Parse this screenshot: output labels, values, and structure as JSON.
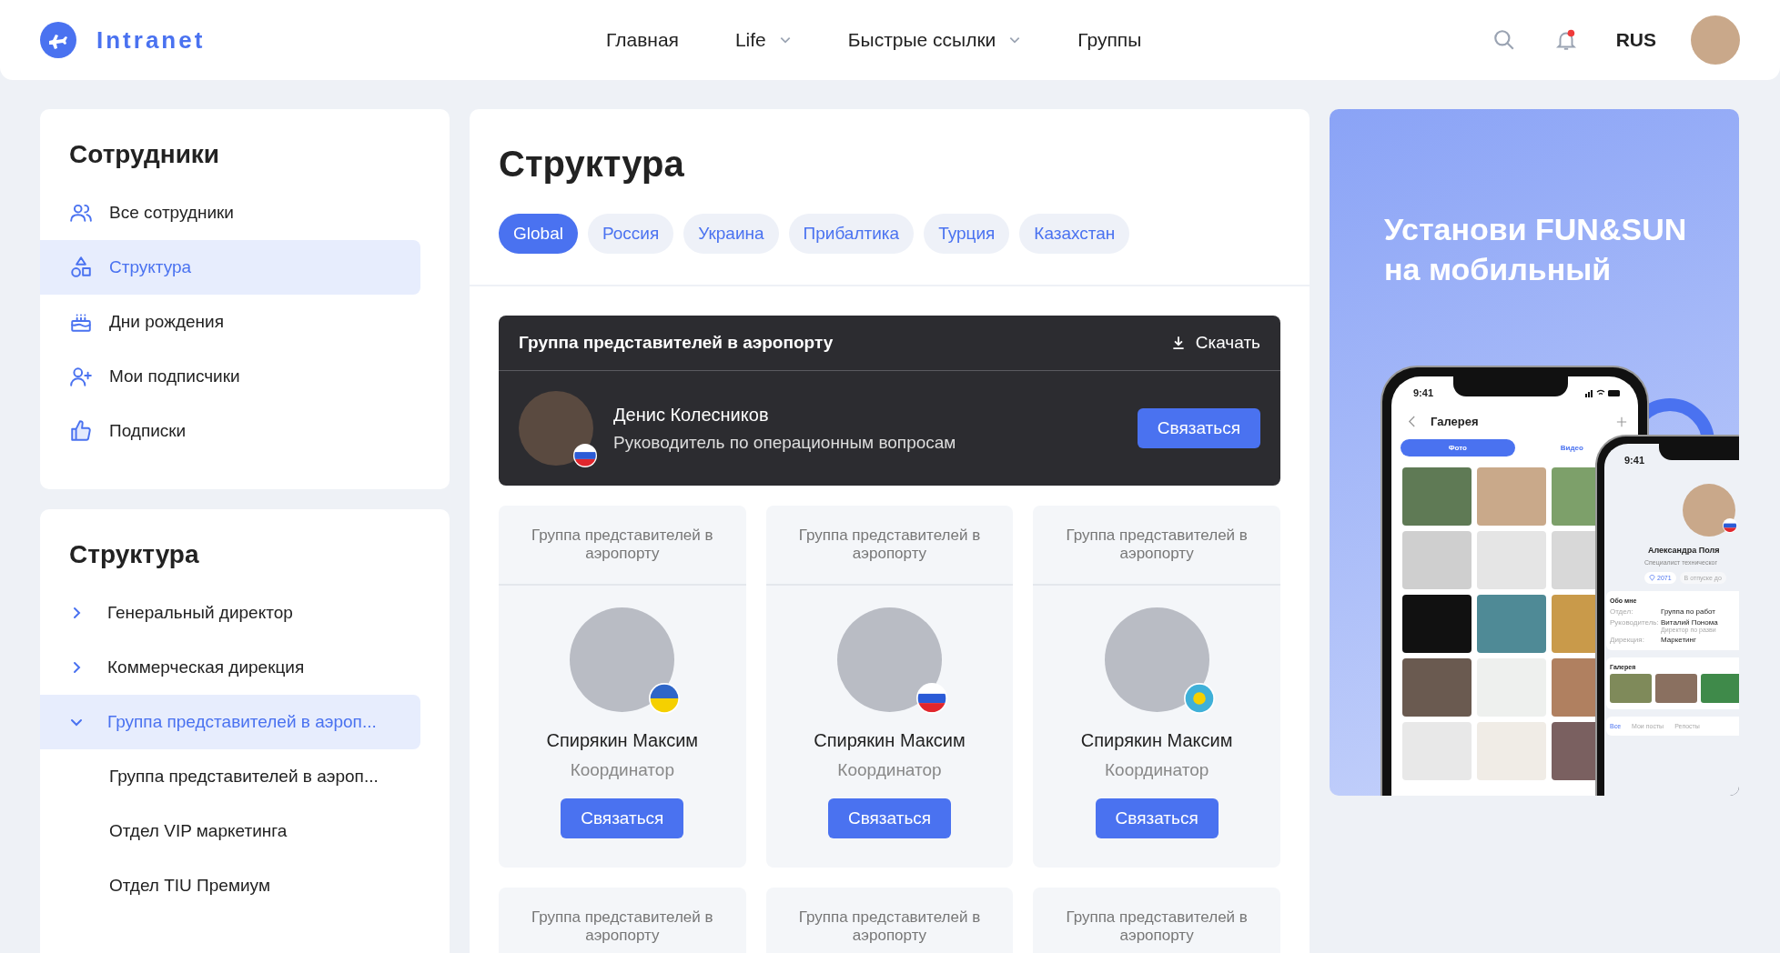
{
  "header": {
    "logo": "Intranet",
    "nav": [
      {
        "label": "Главная",
        "has_menu": false
      },
      {
        "label": "Life",
        "has_menu": true
      },
      {
        "label": "Быстрые ссылки",
        "has_menu": true
      },
      {
        "label": "Группы",
        "has_menu": false
      }
    ],
    "has_unread": true,
    "language": "RUS"
  },
  "employees": {
    "title": "Сотрудники",
    "items": [
      {
        "label": "Все сотрудники",
        "selected": false
      },
      {
        "label": "Структура",
        "selected": true
      },
      {
        "label": "Дни рождения",
        "selected": false
      },
      {
        "label": "Мои подписчики",
        "selected": false
      },
      {
        "label": "Подписки",
        "selected": false
      }
    ]
  },
  "structure_nav": {
    "title": "Структура",
    "tree": [
      {
        "label": "Генеральный директор",
        "expanded": false,
        "selected": false
      },
      {
        "label": "Коммерческая дирекция",
        "expanded": false,
        "selected": false
      },
      {
        "label": "Группа представителей в аэроп...",
        "expanded": true,
        "selected": true,
        "children": [
          {
            "label": "Группа представителей в аэроп...",
            "selected": false
          },
          {
            "label": "Отдел VIP маркетинга",
            "selected": false
          },
          {
            "label": "Отдел TIU Премиум",
            "selected": false
          }
        ]
      }
    ]
  },
  "main": {
    "title": "Структура",
    "tabs": [
      {
        "label": "Global",
        "selected": true
      },
      {
        "label": "Россия",
        "selected": false
      },
      {
        "label": "Украина",
        "selected": false
      },
      {
        "label": "Прибалтика",
        "selected": false
      },
      {
        "label": "Турция",
        "selected": false
      },
      {
        "label": "Казахстан",
        "selected": false
      }
    ],
    "featured": {
      "group": "Группа представителей в аэропорту",
      "download": "Скачать",
      "name": "Денис Колесников",
      "role": "Руководитель по операционным вопросам",
      "button": "Связаться"
    },
    "cards": [
      {
        "group": "Группа представителей в аэропорту",
        "name": "Спирякин Максим",
        "role": "Координатор",
        "kind": "ua",
        "button": "Связаться"
      },
      {
        "group": "Группа представителей в аэропорту",
        "name": "Спирякин Максим",
        "role": "Координатор",
        "kind": "ru",
        "button": "Связаться"
      },
      {
        "group": "Группа представителей в аэропорту",
        "name": "Спирякин Максим",
        "role": "Координатор",
        "kind": "kz",
        "button": "Связаться"
      },
      {
        "group": "Группа представителей в аэропорту"
      },
      {
        "group": "Группа представителей в аэропорту"
      },
      {
        "group": "Группа представителей в аэропорту"
      }
    ]
  },
  "banner": {
    "title": "Установи FUN&SUN на мобильный",
    "gallery_phone": {
      "time": "9:41",
      "title": "Галерея",
      "tabs": [
        {
          "label": "Фото",
          "selected": true
        },
        {
          "label": "Видео",
          "selected": false
        }
      ]
    },
    "profile_phone": {
      "time": "9:41",
      "name": "Александра Поля",
      "role": "Специалист техническог",
      "points": "2071",
      "status": "В отпуске до",
      "about_title": "Обо мне",
      "about": [
        {
          "label": "Отдел:",
          "value": "Группа по работ"
        },
        {
          "label": "Руководитель:",
          "value": "Виталий Понома",
          "note": "Директор по разви"
        },
        {
          "label": "Дирекция:",
          "value": "Маркетинг"
        }
      ],
      "gallery_title": "Галерея",
      "tabs": [
        {
          "label": "Все",
          "selected": true
        },
        {
          "label": "Мои посты",
          "selected": false
        },
        {
          "label": "Репосты",
          "selected": false
        }
      ]
    }
  }
}
